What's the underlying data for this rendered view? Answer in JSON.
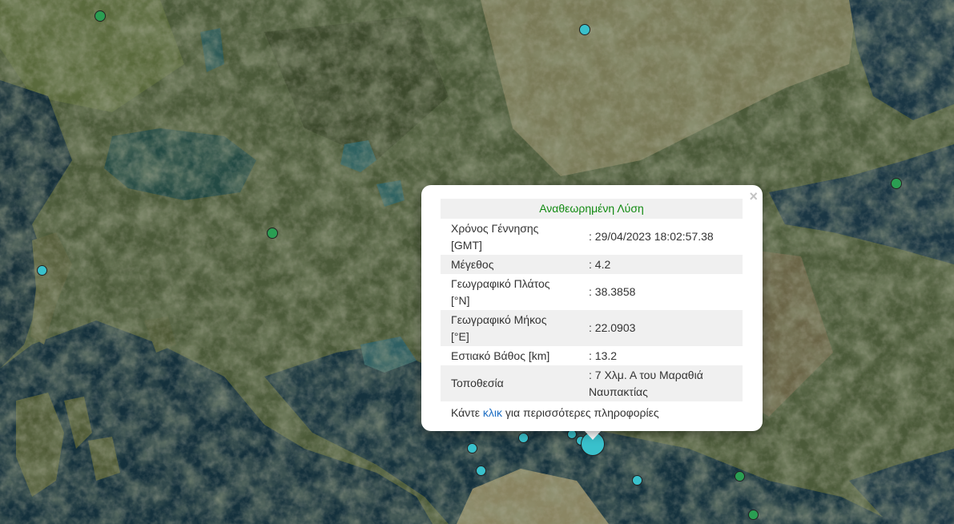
{
  "popup": {
    "title": "Αναθεωρημένη Λύση",
    "close": "×",
    "rows": [
      {
        "label": "Χρόνος Γέννησης [GMT]",
        "value": ": 29/04/2023 18:02:57.38"
      },
      {
        "label": "Μέγεθος",
        "value": ": 4.2"
      },
      {
        "label": "Γεωγραφικό Πλάτος [°N]",
        "value": ": 38.3858"
      },
      {
        "label": "Γεωγραφικό Μήκος [°E]",
        "value": ": 22.0903"
      },
      {
        "label": "Εστιακό Βάθος [km]",
        "value": ": 13.2"
      },
      {
        "label": "Τοποθεσία",
        "value": ": 7 Χλμ. Α του Μαραθιά Ναυπακτίας"
      }
    ],
    "more_before": "Κάντε ",
    "more_link": "κλικ",
    "more_after": " για περισσότερες πληροφορίες"
  },
  "colors": {
    "marker_cyan": "#39c1cc",
    "marker_green": "#2a9e52",
    "title_green": "#128a12",
    "link_blue": "#1f6fc4"
  },
  "marker_icons": [
    "earthquake-marker-icon"
  ]
}
